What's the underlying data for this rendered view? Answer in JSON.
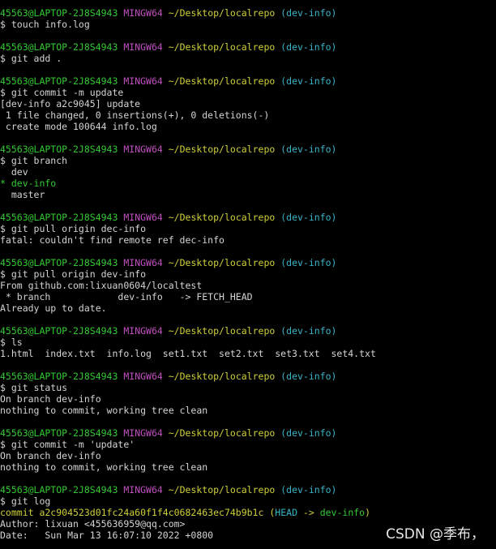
{
  "prompt": {
    "user_host": "45563@LAPTOP-2J8S4943",
    "shell": "MINGW64",
    "path": "~/Desktop/localrepo",
    "branch": "(dev-info)"
  },
  "blocks": [
    {
      "command": "$ touch info.log",
      "output": []
    },
    {
      "command": "$ git add .",
      "output": []
    },
    {
      "command": "$ git commit -m update",
      "output": [
        "[dev-info a2c9045] update",
        " 1 file changed, 0 insertions(+), 0 deletions(-)",
        " create mode 100644 info.log"
      ]
    },
    {
      "command": "$ git branch",
      "output": [
        "  dev"
      ],
      "current_branch_line": "* dev-info",
      "output_after": [
        "  master"
      ]
    },
    {
      "command": "$ git pull origin dec-info",
      "output": [
        "fatal: couldn't find remote ref dec-info"
      ]
    },
    {
      "command": "$ git pull origin dev-info",
      "output": [
        "From github.com:lixuan0604/localtest",
        " * branch            dev-info   -> FETCH_HEAD",
        "Already up to date."
      ]
    },
    {
      "command": "$ ls",
      "output": [
        "1.html  index.txt  info.log  set1.txt  set2.txt  set3.txt  set4.txt"
      ]
    },
    {
      "command": "$ git status",
      "output": [
        "On branch dev-info",
        "nothing to commit, working tree clean"
      ]
    },
    {
      "command": "$ git commit -m 'update'",
      "output": [
        "On branch dev-info",
        "nothing to commit, working tree clean"
      ]
    },
    {
      "command": "$ git log",
      "output": []
    }
  ],
  "log": {
    "commit_label": "commit a2c904523d01fc24a60f1f4c0682463ec74b9b1c",
    "ref_open": "(",
    "head": "HEAD",
    "arrow": " -> ",
    "ref_branch": "dev-info",
    "ref_close": ")",
    "author": "Author: lixuan <455636959@qq.com>",
    "date": "Date:   Sun Mar 13 16:07:10 2022 +0800"
  },
  "watermark": "CSDN @季布，",
  "colors": {
    "background": "#000000",
    "user_host": "#34c934",
    "shell": "#c050c0",
    "path": "#cfcf3a",
    "branch": "#3ab4c8",
    "text": "#d4d4d4"
  }
}
